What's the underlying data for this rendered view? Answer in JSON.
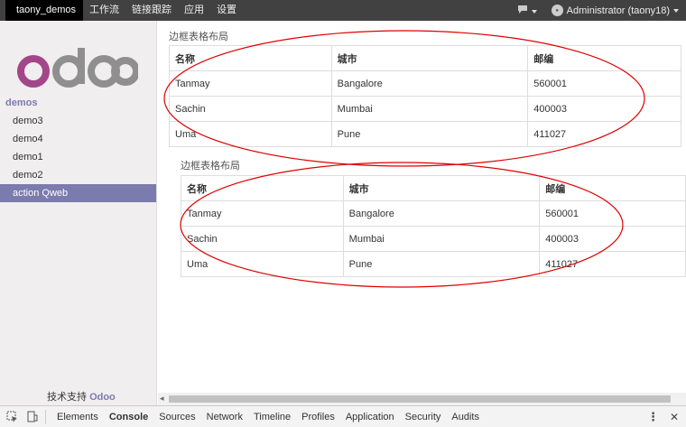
{
  "topbar": {
    "brand": "taony_demos",
    "menu": [
      "工作流",
      "链接跟踪",
      "应用",
      "设置"
    ],
    "chat_icon": "chat-icon",
    "user": "Administrator (taony18)"
  },
  "sidebar": {
    "logo_text": "odoo",
    "section": "demos",
    "items": [
      "demo3",
      "demo4",
      "demo1",
      "demo2",
      "action Qweb"
    ],
    "support_prefix": "技术支持",
    "support_brand": "Odoo"
  },
  "table1": {
    "caption": "边框表格布局",
    "headers": [
      "名称",
      "城市",
      "邮编"
    ],
    "rows": [
      [
        "Tanmay",
        "Bangalore",
        "560001"
      ],
      [
        "Sachin",
        "Mumbai",
        "400003"
      ],
      [
        "Uma",
        "Pune",
        "411027"
      ]
    ]
  },
  "table2": {
    "caption": "边框表格布局",
    "headers": [
      "名称",
      "城市",
      "邮编"
    ],
    "rows": [
      [
        "Tanmay",
        "Bangalore",
        "560001"
      ],
      [
        "Sachin",
        "Mumbai",
        "400003"
      ],
      [
        "Uma",
        "Pune",
        "411027"
      ]
    ]
  },
  "devtools": {
    "tabs": [
      "Elements",
      "Console",
      "Sources",
      "Network",
      "Timeline",
      "Profiles",
      "Application",
      "Security",
      "Audits"
    ],
    "active_tab": "Console"
  },
  "colors": {
    "accent": "#7c7bad",
    "annotation": "#e00000",
    "topbar": "#414141"
  }
}
